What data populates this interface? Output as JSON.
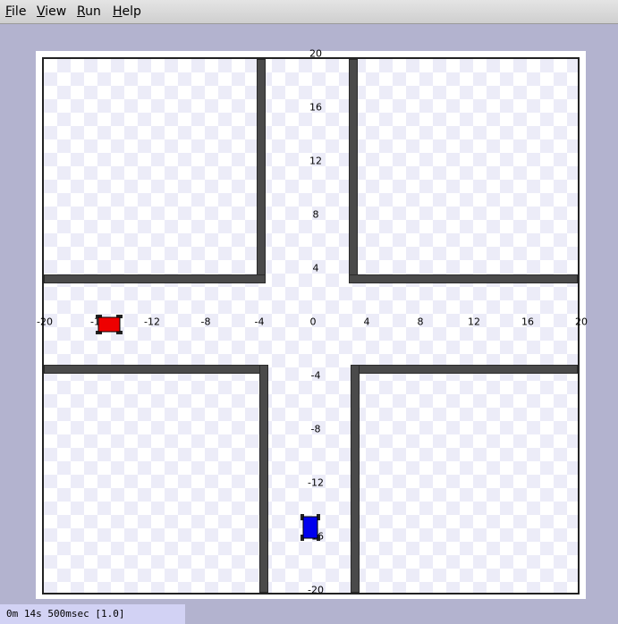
{
  "menubar": {
    "items": [
      {
        "label": "File",
        "mnemonic": "F",
        "rest": "ile"
      },
      {
        "label": "View",
        "mnemonic": "V",
        "rest": "iew"
      },
      {
        "label": "Run",
        "mnemonic": "R",
        "rest": "un"
      },
      {
        "label": "Help",
        "mnemonic": "H",
        "rest": "elp"
      }
    ]
  },
  "arena": {
    "x_ticks": [
      "-20",
      "-16",
      "-12",
      "-8",
      "-4",
      "0",
      "4",
      "8",
      "12",
      "16",
      "20"
    ],
    "y_ticks": [
      "20",
      "16",
      "12",
      "8",
      "4",
      "-4",
      "-8",
      "-12",
      "-16",
      "-20"
    ],
    "robots": [
      {
        "name": "red-robot",
        "color": "#ee0000",
        "x": -15.5,
        "y": 0,
        "heading": "horizontal"
      },
      {
        "name": "blue-robot",
        "color": "#0000ee",
        "x": -0.2,
        "y": -15.5,
        "heading": "vertical"
      }
    ]
  },
  "status": {
    "text": "0m 14s 500msec [1.0]"
  }
}
